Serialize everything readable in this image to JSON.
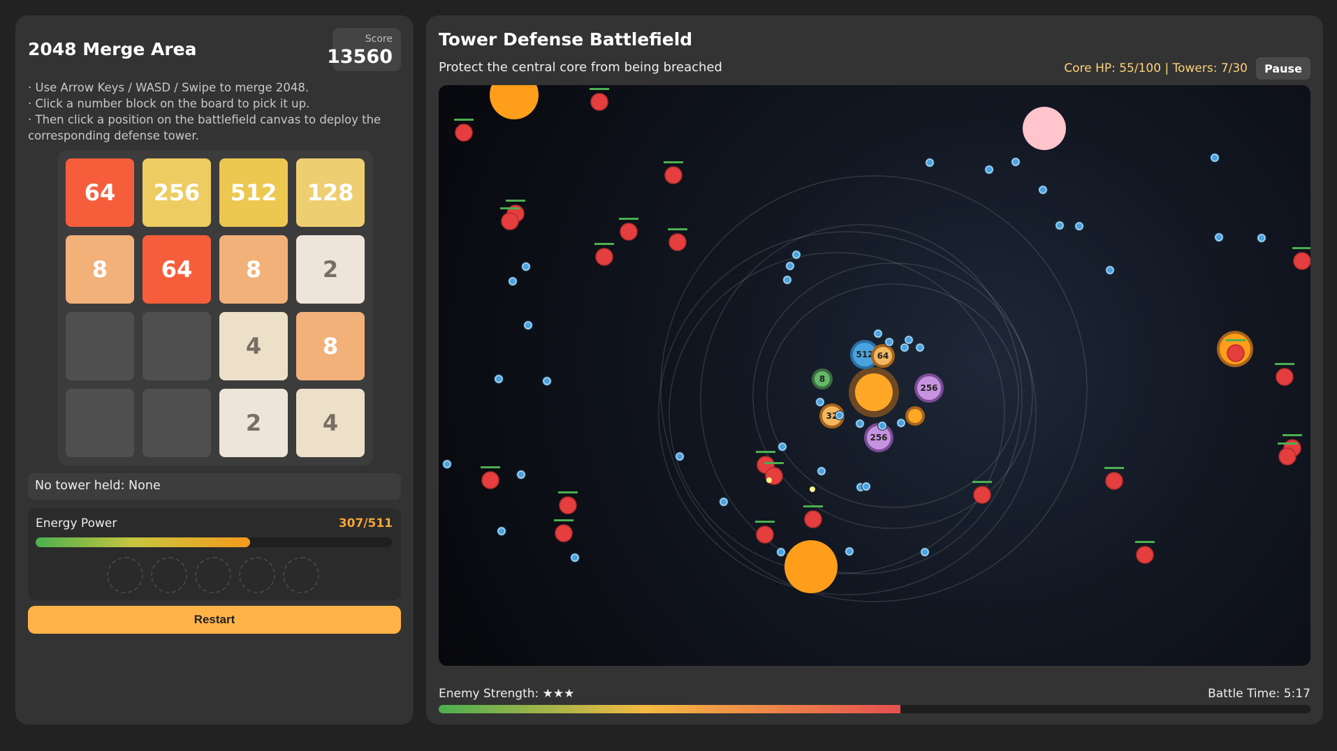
{
  "merge": {
    "title": "2048 Merge Area",
    "score_label": "Score",
    "score_value": "13560",
    "instructions": [
      "· Use Arrow Keys / WASD / Swipe to merge 2048.",
      "· Click a number block on the board to pick it up.",
      "· Then click a position on the battlefield canvas to deploy the corresponding defense tower."
    ],
    "board": [
      [
        "64",
        "256",
        "512",
        "128"
      ],
      [
        "8",
        "64",
        "8",
        "2"
      ],
      [
        "",
        "",
        "4",
        "8"
      ],
      [
        "",
        "",
        "2",
        "4"
      ]
    ],
    "held_text": "No tower held: None",
    "energy_label": "Energy Power",
    "energy_value": "307/511",
    "energy_fraction": 0.601,
    "slot_count": 5,
    "restart_label": "Restart"
  },
  "battle": {
    "title": "Tower Defense Battlefield",
    "subtitle": "Protect the central core from being breached",
    "status": "Core HP: 55/100 | Towers: 7/30",
    "pause_label": "Pause",
    "enemy_strength_label": "Enemy Strength: ★★★",
    "battle_time": "Battle Time: 5:17",
    "enemy_strength_fraction": 0.53,
    "towers": [
      "512",
      "64",
      "8",
      "256",
      "32",
      "256"
    ]
  },
  "colors": {
    "tile_64": "#f65e3b",
    "tile_256": "#edcc61",
    "tile_512": "#edc850",
    "tile_128": "#edcf72",
    "tile_8": "#f2b179",
    "tile_4": "#ede0c8",
    "tile_2": "#eee4da",
    "tile_empty": "#4f4f4f",
    "enemy": "#e53e3e",
    "bullet": "#4aa3df",
    "core": "#ffa726"
  }
}
